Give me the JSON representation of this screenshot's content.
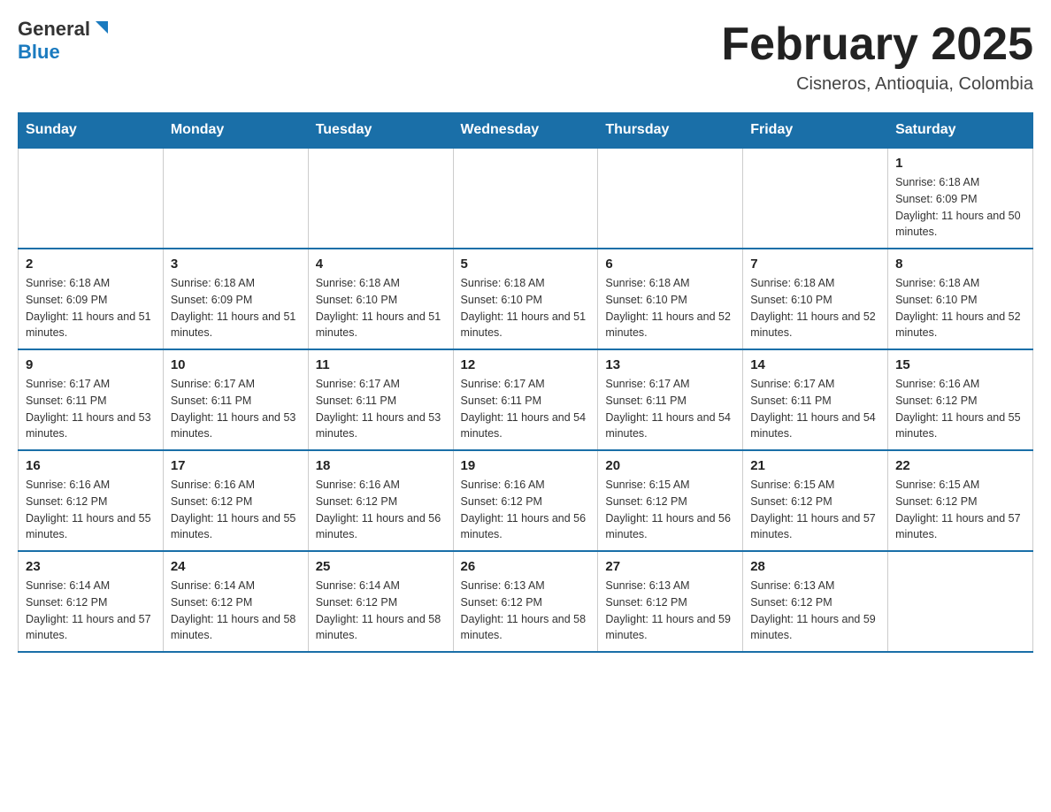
{
  "header": {
    "logo_general": "General",
    "logo_blue": "Blue",
    "month_title": "February 2025",
    "location": "Cisneros, Antioquia, Colombia"
  },
  "days_of_week": [
    "Sunday",
    "Monday",
    "Tuesday",
    "Wednesday",
    "Thursday",
    "Friday",
    "Saturday"
  ],
  "weeks": [
    [
      {
        "day": "",
        "info": ""
      },
      {
        "day": "",
        "info": ""
      },
      {
        "day": "",
        "info": ""
      },
      {
        "day": "",
        "info": ""
      },
      {
        "day": "",
        "info": ""
      },
      {
        "day": "",
        "info": ""
      },
      {
        "day": "1",
        "info": "Sunrise: 6:18 AM\nSunset: 6:09 PM\nDaylight: 11 hours and 50 minutes."
      }
    ],
    [
      {
        "day": "2",
        "info": "Sunrise: 6:18 AM\nSunset: 6:09 PM\nDaylight: 11 hours and 51 minutes."
      },
      {
        "day": "3",
        "info": "Sunrise: 6:18 AM\nSunset: 6:09 PM\nDaylight: 11 hours and 51 minutes."
      },
      {
        "day": "4",
        "info": "Sunrise: 6:18 AM\nSunset: 6:10 PM\nDaylight: 11 hours and 51 minutes."
      },
      {
        "day": "5",
        "info": "Sunrise: 6:18 AM\nSunset: 6:10 PM\nDaylight: 11 hours and 51 minutes."
      },
      {
        "day": "6",
        "info": "Sunrise: 6:18 AM\nSunset: 6:10 PM\nDaylight: 11 hours and 52 minutes."
      },
      {
        "day": "7",
        "info": "Sunrise: 6:18 AM\nSunset: 6:10 PM\nDaylight: 11 hours and 52 minutes."
      },
      {
        "day": "8",
        "info": "Sunrise: 6:18 AM\nSunset: 6:10 PM\nDaylight: 11 hours and 52 minutes."
      }
    ],
    [
      {
        "day": "9",
        "info": "Sunrise: 6:17 AM\nSunset: 6:11 PM\nDaylight: 11 hours and 53 minutes."
      },
      {
        "day": "10",
        "info": "Sunrise: 6:17 AM\nSunset: 6:11 PM\nDaylight: 11 hours and 53 minutes."
      },
      {
        "day": "11",
        "info": "Sunrise: 6:17 AM\nSunset: 6:11 PM\nDaylight: 11 hours and 53 minutes."
      },
      {
        "day": "12",
        "info": "Sunrise: 6:17 AM\nSunset: 6:11 PM\nDaylight: 11 hours and 54 minutes."
      },
      {
        "day": "13",
        "info": "Sunrise: 6:17 AM\nSunset: 6:11 PM\nDaylight: 11 hours and 54 minutes."
      },
      {
        "day": "14",
        "info": "Sunrise: 6:17 AM\nSunset: 6:11 PM\nDaylight: 11 hours and 54 minutes."
      },
      {
        "day": "15",
        "info": "Sunrise: 6:16 AM\nSunset: 6:12 PM\nDaylight: 11 hours and 55 minutes."
      }
    ],
    [
      {
        "day": "16",
        "info": "Sunrise: 6:16 AM\nSunset: 6:12 PM\nDaylight: 11 hours and 55 minutes."
      },
      {
        "day": "17",
        "info": "Sunrise: 6:16 AM\nSunset: 6:12 PM\nDaylight: 11 hours and 55 minutes."
      },
      {
        "day": "18",
        "info": "Sunrise: 6:16 AM\nSunset: 6:12 PM\nDaylight: 11 hours and 56 minutes."
      },
      {
        "day": "19",
        "info": "Sunrise: 6:16 AM\nSunset: 6:12 PM\nDaylight: 11 hours and 56 minutes."
      },
      {
        "day": "20",
        "info": "Sunrise: 6:15 AM\nSunset: 6:12 PM\nDaylight: 11 hours and 56 minutes."
      },
      {
        "day": "21",
        "info": "Sunrise: 6:15 AM\nSunset: 6:12 PM\nDaylight: 11 hours and 57 minutes."
      },
      {
        "day": "22",
        "info": "Sunrise: 6:15 AM\nSunset: 6:12 PM\nDaylight: 11 hours and 57 minutes."
      }
    ],
    [
      {
        "day": "23",
        "info": "Sunrise: 6:14 AM\nSunset: 6:12 PM\nDaylight: 11 hours and 57 minutes."
      },
      {
        "day": "24",
        "info": "Sunrise: 6:14 AM\nSunset: 6:12 PM\nDaylight: 11 hours and 58 minutes."
      },
      {
        "day": "25",
        "info": "Sunrise: 6:14 AM\nSunset: 6:12 PM\nDaylight: 11 hours and 58 minutes."
      },
      {
        "day": "26",
        "info": "Sunrise: 6:13 AM\nSunset: 6:12 PM\nDaylight: 11 hours and 58 minutes."
      },
      {
        "day": "27",
        "info": "Sunrise: 6:13 AM\nSunset: 6:12 PM\nDaylight: 11 hours and 59 minutes."
      },
      {
        "day": "28",
        "info": "Sunrise: 6:13 AM\nSunset: 6:12 PM\nDaylight: 11 hours and 59 minutes."
      },
      {
        "day": "",
        "info": ""
      }
    ]
  ]
}
